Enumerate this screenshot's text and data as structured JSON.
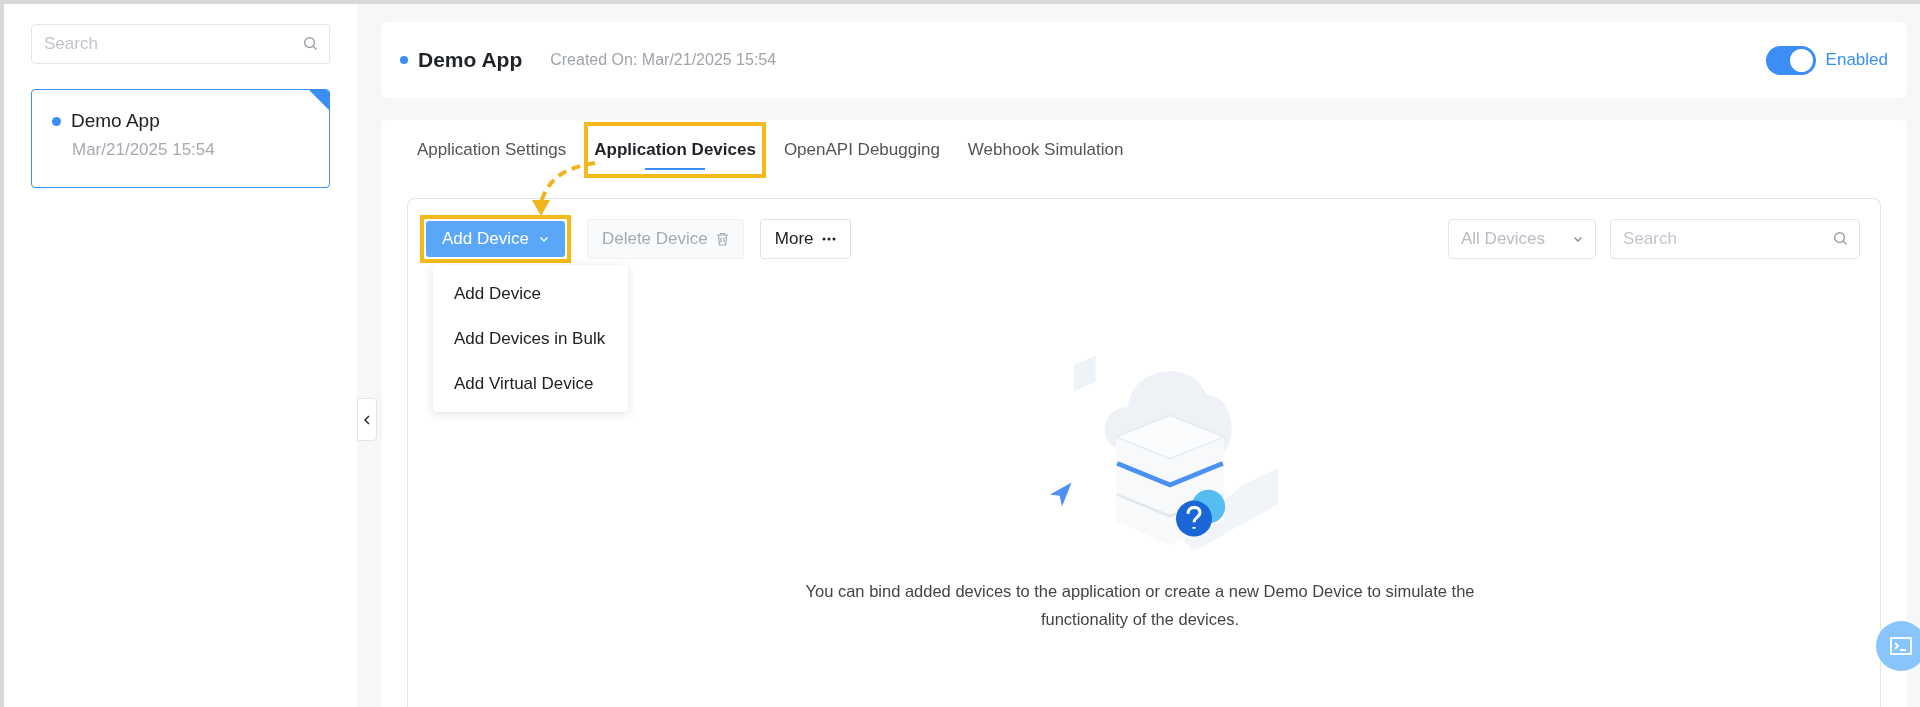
{
  "sidebar": {
    "search": {
      "placeholder": "Search"
    },
    "apps": [
      {
        "name": "Demo App",
        "date": "Mar/21/2025 15:54",
        "selected": true
      }
    ]
  },
  "header": {
    "title": "Demo App",
    "created": "Created On: Mar/21/2025 15:54",
    "enabled": {
      "on": true,
      "label": "Enabled"
    }
  },
  "tabs": [
    {
      "label": "Application Settings",
      "selected": false,
      "highlighted": false
    },
    {
      "label": "Application Devices",
      "selected": true,
      "highlighted": true
    },
    {
      "label": "OpenAPI Debugging",
      "selected": false,
      "highlighted": false
    },
    {
      "label": "Webhook Simulation",
      "selected": false,
      "highlighted": false
    }
  ],
  "toolbar": {
    "add_button": {
      "label": "Add Device",
      "highlighted": true,
      "expanded": true
    },
    "delete_button": {
      "label": "Delete Device",
      "disabled": true
    },
    "more_button": {
      "label": "More"
    },
    "filter": {
      "placeholder": "All Devices"
    },
    "search": {
      "placeholder": "Search"
    }
  },
  "add_menu": [
    "Add Device",
    "Add Devices in Bulk",
    "Add Virtual Device"
  ],
  "empty_message": "You can bind added devices to the application or create a new Demo Device to simulate the functionality of the devices."
}
